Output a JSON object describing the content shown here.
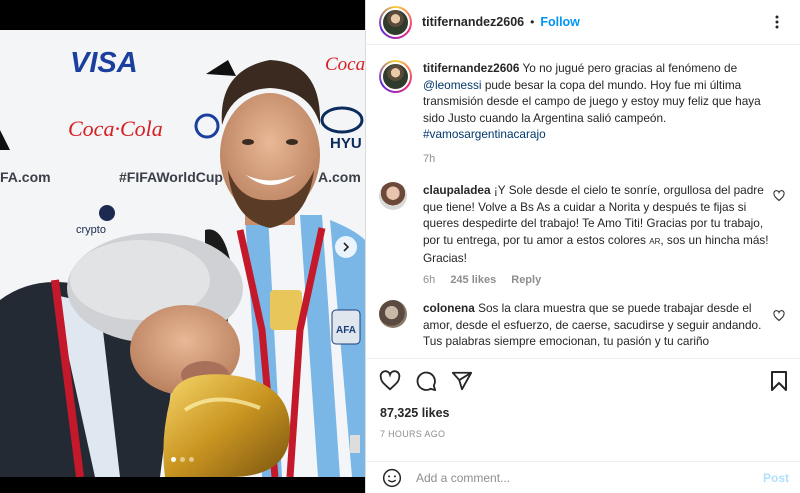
{
  "post": {
    "username": "titifernandez2606",
    "separator": "•",
    "follow_label": "Follow",
    "caption_mention": "@leomessi",
    "caption_before": "Yo no jugué pero gracias al fenómeno de",
    "caption_after": "pude besar la copa del mundo. Hoy fue mi última transmisión desde el campo de juego y estoy muy feliz que haya sido Justo cuando la Argentina salió campeón.",
    "caption_hashtag": "#vamosargentinacarajo",
    "caption_time": "7h"
  },
  "comments": [
    {
      "username": "claupaladea",
      "text": "¡Y Sole desde el cielo te sonríe, orgullosa del padre que tiene! Volve a Bs As a cuidar a Norita y después te fijas si queres despedirte del trabajo! Te Amo Titi! Gracias por tu trabajo, por tu entrega, por tu amor a estos colores",
      "flag": "AR",
      "text_end": ", sos un hincha más! Gracias!",
      "time": "6h",
      "likes": "245 likes",
      "reply": "Reply"
    },
    {
      "username": "colonena",
      "text": "Sos la clara muestra que se puede trabajar desde el amor, desde el esfuerzo, de caerse, sacudirse y seguir andando. Tus palabras siempre emocionan, tu pasión y tu cariño",
      "time": "",
      "likes": "",
      "reply": ""
    }
  ],
  "actions": {
    "likes_count": "87,325 likes",
    "posted_ago": "7 HOURS AGO",
    "comment_placeholder": "Add a comment...",
    "post_label": "Post"
  },
  "media": {
    "board_texts": [
      "VISA",
      "Coca-Cola",
      "Coca·Cola",
      "#FIFAWorldCup",
      "FA.com",
      "A.com",
      "HYU",
      "crypto"
    ],
    "shirt_text": "AFA",
    "carousel_count": 3,
    "carousel_active": 0
  },
  "colors": {
    "accent": "#0095f6",
    "link": "#00376b",
    "muted": "#8e8e8e",
    "post_disabled": "#b2dffc"
  }
}
